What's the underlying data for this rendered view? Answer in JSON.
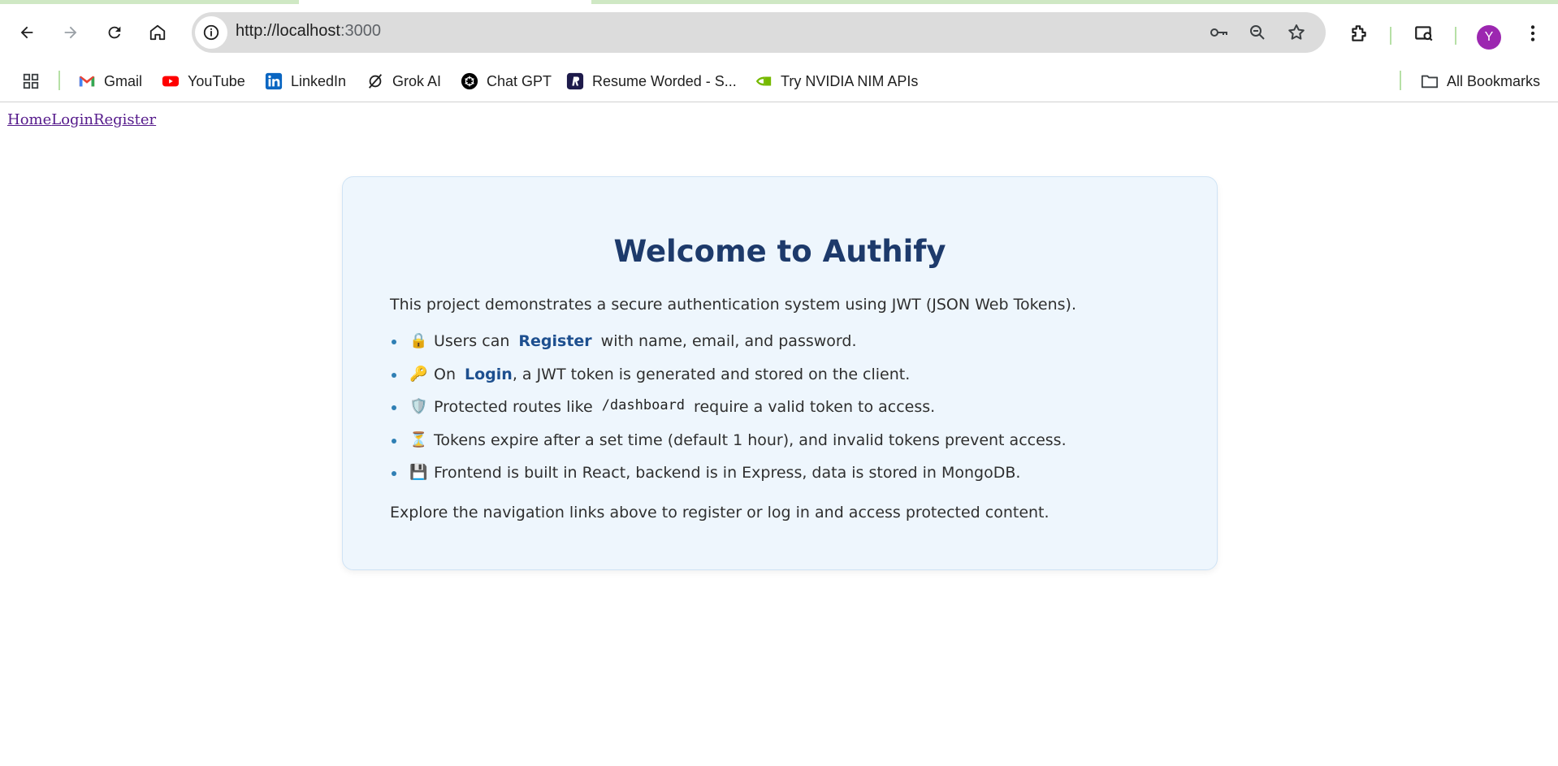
{
  "browser": {
    "url_host": "http://localhost",
    "url_port": ":3000",
    "avatar_initial": "Y",
    "bookmarks": [
      {
        "label": "Gmail"
      },
      {
        "label": "YouTube"
      },
      {
        "label": "LinkedIn"
      },
      {
        "label": "Grok AI"
      },
      {
        "label": "Chat GPT"
      },
      {
        "label": "Resume Worded - S..."
      },
      {
        "label": "Try NVIDIA NIM APIs"
      }
    ],
    "all_bookmarks": "All Bookmarks"
  },
  "nav": {
    "home": "Home",
    "login": "Login",
    "register": "Register"
  },
  "card": {
    "title": "Welcome to Authify",
    "intro": "This project demonstrates a secure authentication system using JWT (JSON Web Tokens).",
    "items": [
      {
        "emoji": "🔒",
        "pre": "Users can",
        "link": "Register",
        "post": "with name, email, and password."
      },
      {
        "emoji": "🔑",
        "pre": "On",
        "link": "Login",
        "post": ", a JWT token is generated and stored on the client."
      },
      {
        "emoji": "🛡️",
        "pre": "Protected routes like",
        "code": "/dashboard",
        "post": "require a valid token to access."
      },
      {
        "emoji": "⏳",
        "text": "Tokens expire after a set time (default 1 hour), and invalid tokens prevent access."
      },
      {
        "emoji": "💾",
        "text": "Frontend is built in React, backend is in Express, data is stored in MongoDB."
      }
    ],
    "outro": "Explore the navigation links above to register or log in and access protected content."
  },
  "colors": {
    "title": "#1d3a6b",
    "card_bg": "#eef6fd",
    "link_visited": "#551a8b",
    "avatar": "#9c27b0"
  }
}
